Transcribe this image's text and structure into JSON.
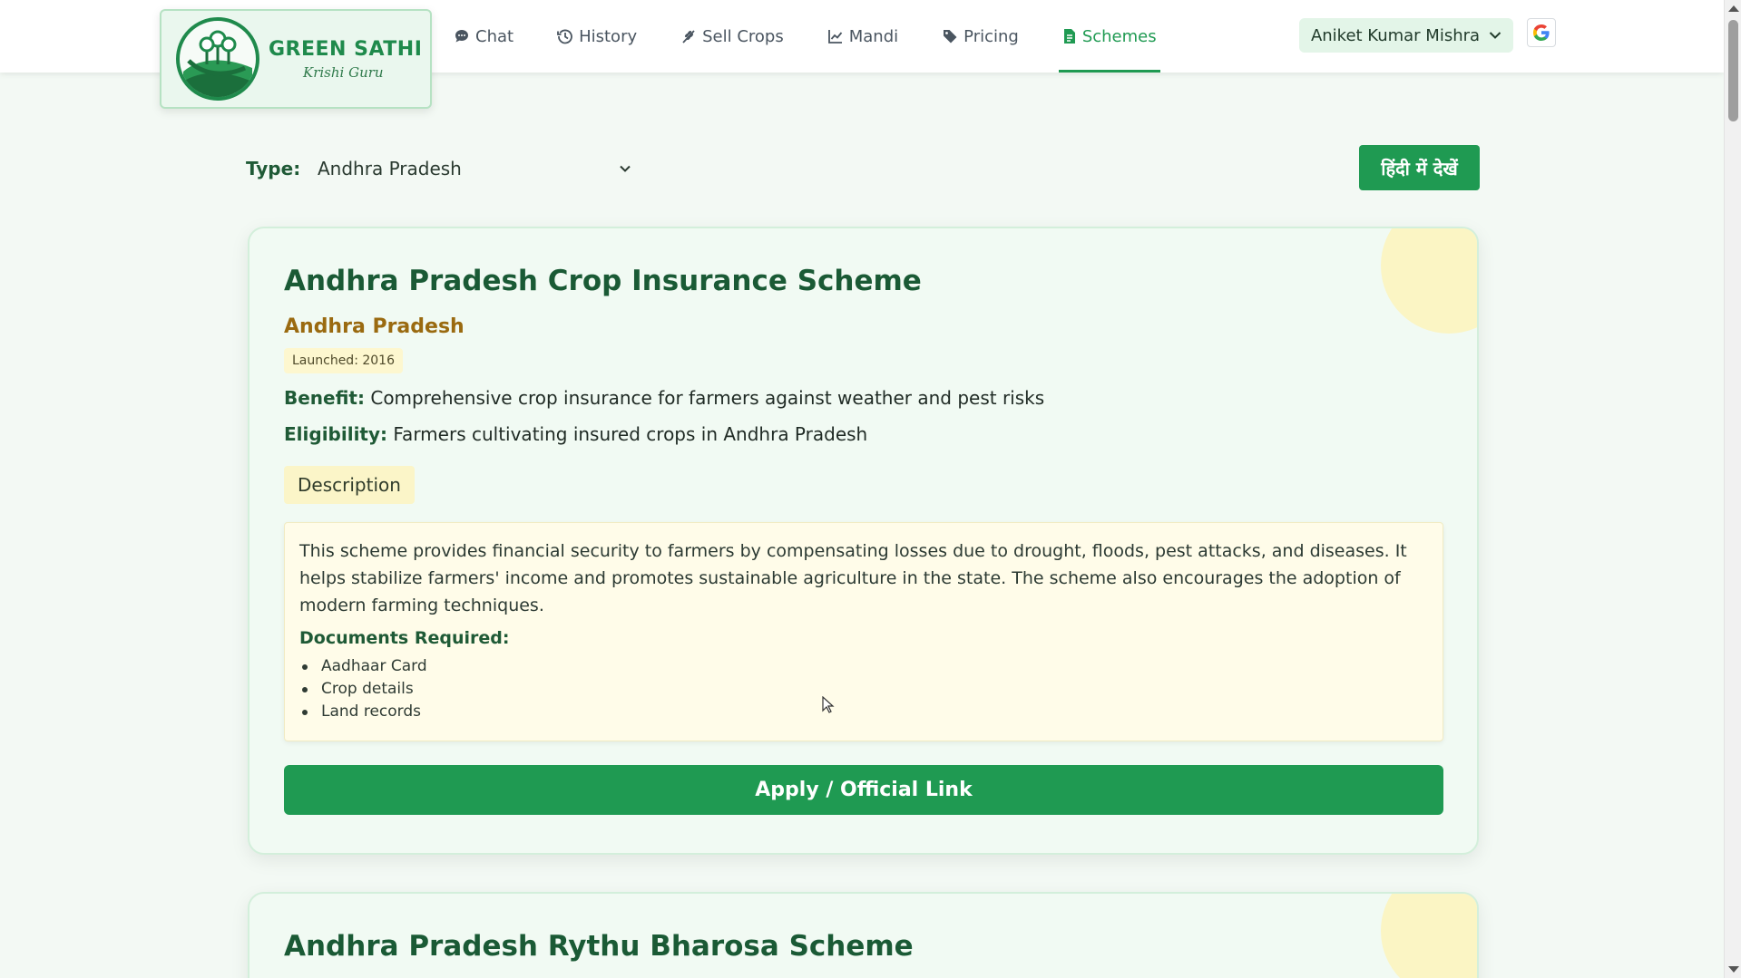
{
  "brand": {
    "name": "GREEN SATHI",
    "tagline": "Krishi Guru",
    "accent_color": "#1f9a52"
  },
  "nav": {
    "items": [
      {
        "label": "Chat",
        "icon": "chat-bubble-icon",
        "active": false
      },
      {
        "label": "History",
        "icon": "history-icon",
        "active": false
      },
      {
        "label": "Sell Crops",
        "icon": "seedling-icon",
        "active": false
      },
      {
        "label": "Mandi",
        "icon": "line-chart-icon",
        "active": false
      },
      {
        "label": "Pricing",
        "icon": "tag-icon",
        "active": false
      },
      {
        "label": "Schemes",
        "icon": "document-icon",
        "active": true
      }
    ]
  },
  "user": {
    "name": "Aniket Kumar Mishra",
    "google_icon": "google-icon"
  },
  "filter": {
    "type_label": "Type:",
    "selected": "Andhra Pradesh",
    "hindi_button": "हिंदी में देखें"
  },
  "schemes": [
    {
      "title": "Andhra Pradesh Crop Insurance Scheme",
      "state": "Andhra Pradesh",
      "launched": "Launched: 2016",
      "benefit_label": "Benefit:",
      "benefit": "Comprehensive crop insurance for farmers against weather and pest risks",
      "eligibility_label": "Eligibility:",
      "eligibility": "Farmers cultivating insured crops in Andhra Pradesh",
      "description_tab": "Description",
      "description": "This scheme provides financial security to farmers by compensating losses due to drought, floods, pest attacks, and diseases. It helps stabilize farmers' income and promotes sustainable agriculture in the state. The scheme also encourages the adoption of modern farming techniques.",
      "documents_label": "Documents Required:",
      "documents": [
        "Aadhaar Card",
        "Crop details",
        "Land records"
      ],
      "apply_label": "Apply / Official Link"
    },
    {
      "title": "Andhra Pradesh Rythu Bharosa Scheme"
    }
  ]
}
